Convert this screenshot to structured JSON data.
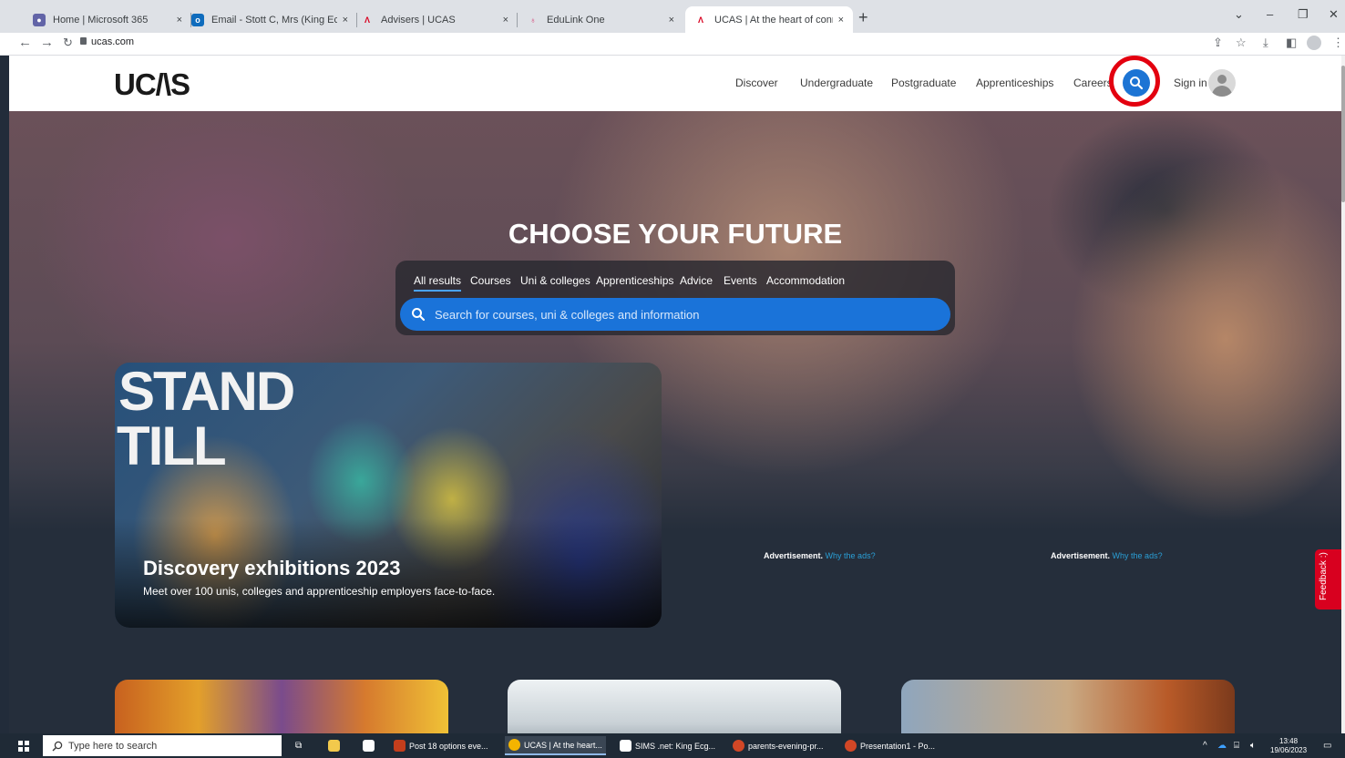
{
  "browser": {
    "tabs": [
      {
        "title": "Home | Microsoft 365",
        "close": "×"
      },
      {
        "title": "Email - Stott C, Mrs (King Ecgbert",
        "close": "×"
      },
      {
        "title": "Advisers | UCAS",
        "close": "×"
      },
      {
        "title": "EduLink One",
        "close": "×"
      },
      {
        "title": "UCAS | At the heart of connecting",
        "close": "×"
      }
    ],
    "new_tab": "+",
    "url": "ucas.com"
  },
  "site": {
    "logo": "UC/\\S",
    "nav": [
      "Discover",
      "Undergraduate",
      "Postgraduate",
      "Apprenticeships",
      "Careers"
    ],
    "sign_in": "Sign in"
  },
  "hero": {
    "headline": "CHOOSE YOUR FUTURE",
    "search_tabs": [
      "All results",
      "Courses",
      "Uni & colleges",
      "Apprenticeships",
      "Advice",
      "Events",
      "Accommodation"
    ],
    "search_placeholder": "Search for courses, uni & colleges and information"
  },
  "feature": {
    "image_text_1": "STAND",
    "image_text_2": "TILL",
    "title": "Discovery exhibitions 2023",
    "subtitle": "Meet over 100 unis, colleges and apprenticeship employers face-to-face."
  },
  "ads": [
    {
      "label": "Advertisement.",
      "link": "Why the ads?"
    },
    {
      "label": "Advertisement.",
      "link": "Why the ads?"
    }
  ],
  "feedback_label": "Feedback :)",
  "taskbar": {
    "search_placeholder": "Type here to search",
    "items": [
      "Post 18 options eve...",
      "UCAS | At the heart...",
      "SIMS .net: King Ecg...",
      "parents-evening-pr...",
      "Presentation1 - Po..."
    ],
    "time": "13:48",
    "date": "19/06/2023"
  },
  "colors": {
    "ucas_blue": "#1c74d4",
    "highlight_ring": "#e3000f",
    "feedback_red": "#d8001f"
  }
}
